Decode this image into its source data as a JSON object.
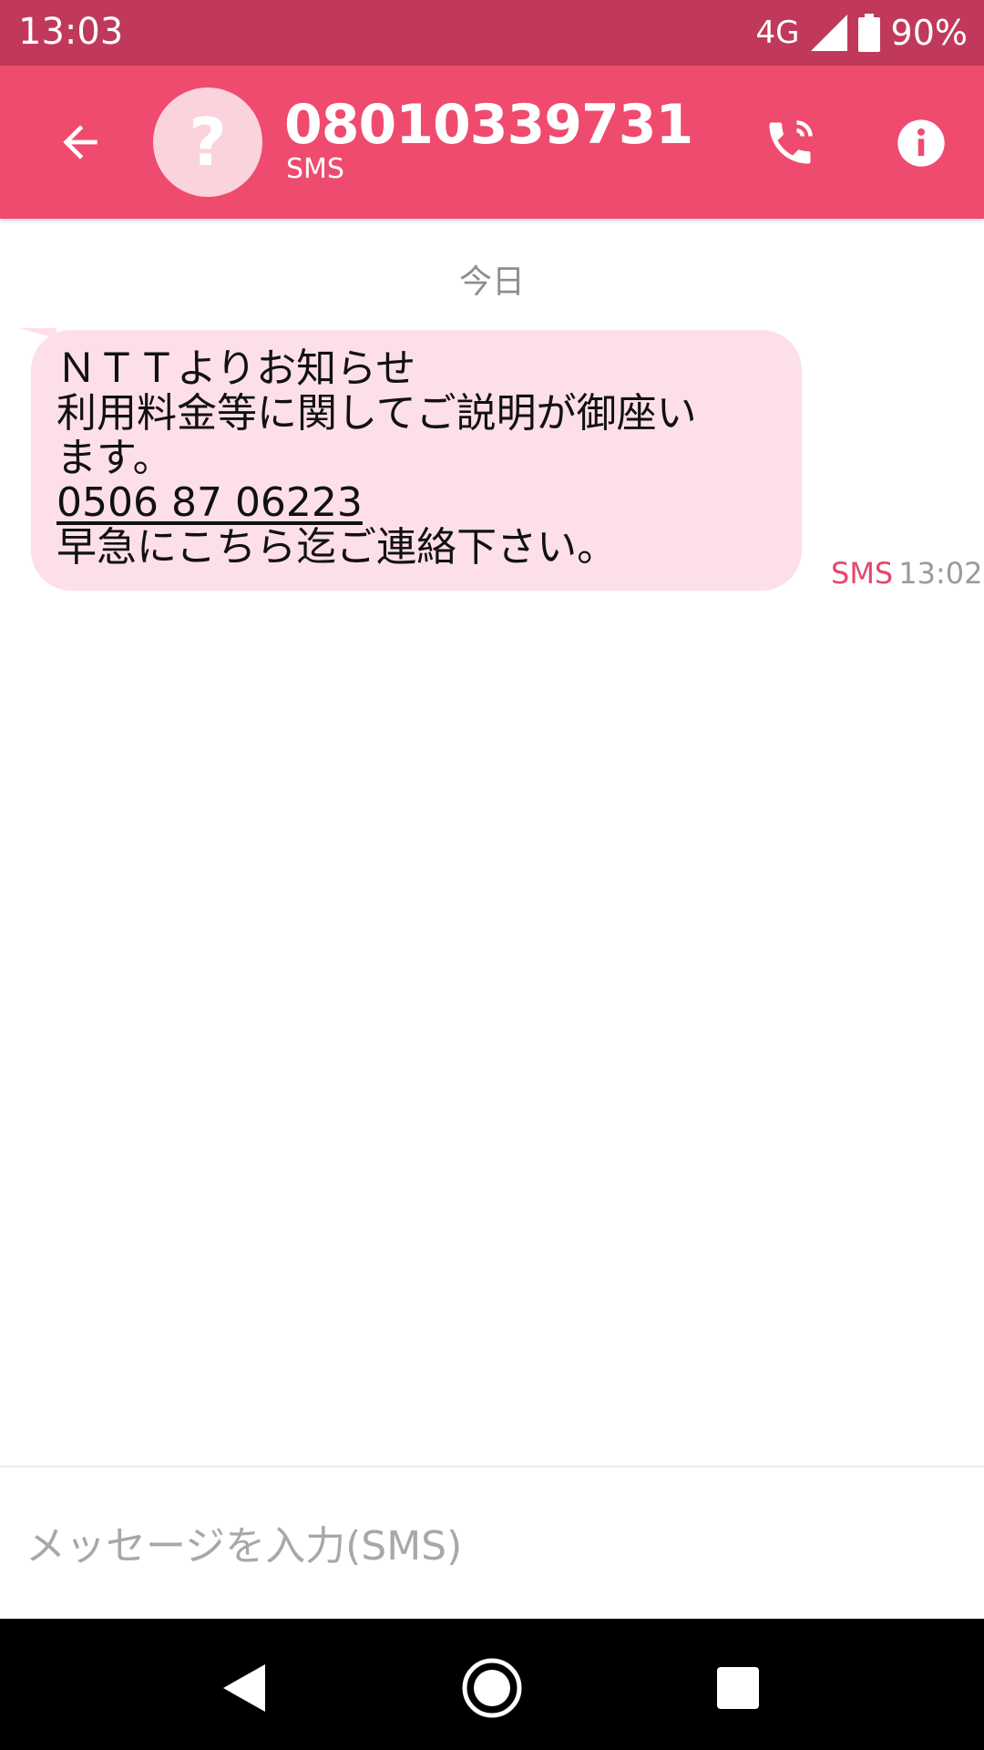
{
  "status_bar": {
    "time": "13:03",
    "network": "4G",
    "battery": "90%",
    "icons": [
      "signal-icon",
      "battery-icon"
    ]
  },
  "header": {
    "contact_number": "08010339731",
    "channel": "SMS",
    "avatar_glyph": "?",
    "icons": [
      "back-arrow-icon",
      "phone-call-icon",
      "info-icon"
    ],
    "accent_color": "#ef4b6e",
    "status_color": "#c0395a"
  },
  "conversation": {
    "date_divider": "今日",
    "messages": [
      {
        "lines": [
          "ＮＴＴよりお知らせ",
          "利用料金等に関してご説明が御座い",
          "ます。"
        ],
        "link": "0506 87 06223",
        "last_line": "早急にこちら迄ご連絡下さい。",
        "type": "SMS",
        "time": "13:02",
        "bubble_color": "#fde0e7"
      }
    ]
  },
  "composer": {
    "placeholder": "メッセージを入力(SMS)"
  },
  "nav": {
    "icons": [
      "nav-back-icon",
      "nav-home-icon",
      "nav-recents-icon"
    ]
  }
}
